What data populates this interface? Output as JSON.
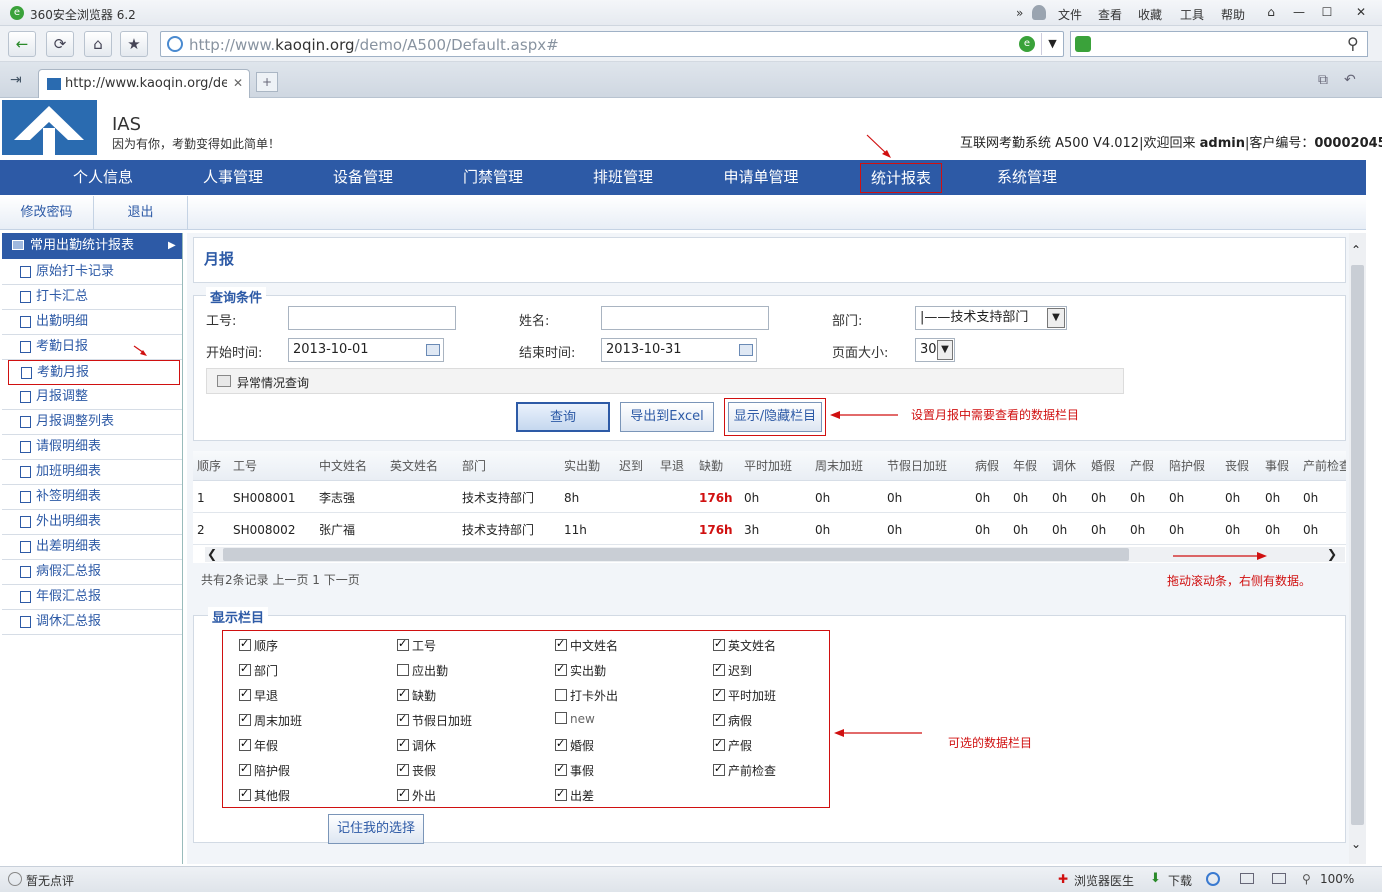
{
  "browser": {
    "app_title": "360安全浏览器 6.2",
    "menu": [
      "文件",
      "查看",
      "收藏",
      "工具",
      "帮助"
    ],
    "url_prefix": "http://www.",
    "url_host": "kaoqin.org",
    "url_path": "/demo/A500/Default.aspx#",
    "tab_label": "http://www.kaoqin.org/dem",
    "status_left": "暂无点评",
    "status_doctor": "浏览器医生",
    "status_download": "下载",
    "zoom": "100%"
  },
  "header": {
    "app_name": "IAS",
    "slogan": "因为有你，考勤变得如此简单！",
    "system_info": "互联网考勤系统 A500 V4.012|欢迎回来",
    "user": "admin",
    "customer_label": "|客户编号：",
    "customer_no": "00002045"
  },
  "topnav": [
    "个人信息",
    "人事管理",
    "设备管理",
    "门禁管理",
    "排班管理",
    "申请单管理",
    "统计报表",
    "系统管理"
  ],
  "subnav": [
    "修改密码",
    "退出"
  ],
  "sidebar": {
    "title": "常用出勤统计报表",
    "items": [
      "原始打卡记录",
      "打卡汇总",
      "出勤明细",
      "考勤日报",
      "考勤月报",
      "月报调整",
      "月报调整列表",
      "请假明细表",
      "加班明细表",
      "补签明细表",
      "外出明细表",
      "出差明细表",
      "病假汇总报",
      "年假汇总报",
      "调休汇总报"
    ]
  },
  "page": {
    "title": "月报",
    "query_legend": "查询条件",
    "emp_no_label": "工号:",
    "name_label": "姓名:",
    "dept_label": "部门:",
    "dept_value": "|——技术支持部门",
    "start_label": "开始时间:",
    "start_value": "2013-10-01",
    "end_label": "结束时间:",
    "end_value": "2013-10-31",
    "page_size_label": "页面大小:",
    "page_size_value": "30",
    "abnormal_query": "异常情况查询",
    "btn_query": "查询",
    "btn_export": "导出到Excel",
    "btn_toggle": "显示/隐藏栏目",
    "annot_toggle": "设置月报中需要查看的数据栏目",
    "annot_scroll": "拖动滚动条，右侧有数据。",
    "annot_options": "可选的数据栏目",
    "pager": "共有2条记录 上一页 1 下一页",
    "display_legend": "显示栏目",
    "btn_remember": "记住我的选择"
  },
  "table": {
    "headers": [
      "顺序",
      "工号",
      "中文姓名",
      "英文姓名",
      "部门",
      "实出勤",
      "迟到",
      "早退",
      "缺勤",
      "平时加班",
      "周末加班",
      "节假日加班",
      "病假",
      "年假",
      "调休",
      "婚假",
      "产假",
      "陪护假",
      "丧假",
      "事假",
      "产前检查"
    ],
    "rows": [
      [
        "1",
        "SH008001",
        "李志强",
        "",
        "技术支持部门",
        "8h",
        "",
        "",
        "176h",
        "0h",
        "0h",
        "0h",
        "0h",
        "0h",
        "0h",
        "0h",
        "0h",
        "0h",
        "0h",
        "0h",
        "0h"
      ],
      [
        "2",
        "SH008002",
        "张广福",
        "",
        "技术支持部门",
        "11h",
        "",
        "",
        "176h",
        "3h",
        "0h",
        "0h",
        "0h",
        "0h",
        "0h",
        "0h",
        "0h",
        "0h",
        "0h",
        "0h",
        "0h"
      ]
    ]
  },
  "columns_options": [
    {
      "label": "顺序",
      "checked": true
    },
    {
      "label": "工号",
      "checked": true
    },
    {
      "label": "中文姓名",
      "checked": true
    },
    {
      "label": "英文姓名",
      "checked": true
    },
    {
      "label": "部门",
      "checked": true
    },
    {
      "label": "应出勤",
      "checked": false
    },
    {
      "label": "实出勤",
      "checked": true
    },
    {
      "label": "迟到",
      "checked": true
    },
    {
      "label": "早退",
      "checked": true
    },
    {
      "label": "缺勤",
      "checked": true
    },
    {
      "label": "打卡外出",
      "checked": false
    },
    {
      "label": "平时加班",
      "checked": true
    },
    {
      "label": "周末加班",
      "checked": true
    },
    {
      "label": "节假日加班",
      "checked": true
    },
    {
      "label": "new",
      "checked": false
    },
    {
      "label": "病假",
      "checked": true
    },
    {
      "label": "年假",
      "checked": true
    },
    {
      "label": "调休",
      "checked": true
    },
    {
      "label": "婚假",
      "checked": true
    },
    {
      "label": "产假",
      "checked": true
    },
    {
      "label": "陪护假",
      "checked": true
    },
    {
      "label": "丧假",
      "checked": true
    },
    {
      "label": "事假",
      "checked": true
    },
    {
      "label": "产前检查",
      "checked": true
    },
    {
      "label": "其他假",
      "checked": true
    },
    {
      "label": "外出",
      "checked": true
    },
    {
      "label": "出差",
      "checked": true
    }
  ],
  "colors": {
    "nav_blue": "#2d5aa6",
    "annotation_red": "#d01010"
  }
}
